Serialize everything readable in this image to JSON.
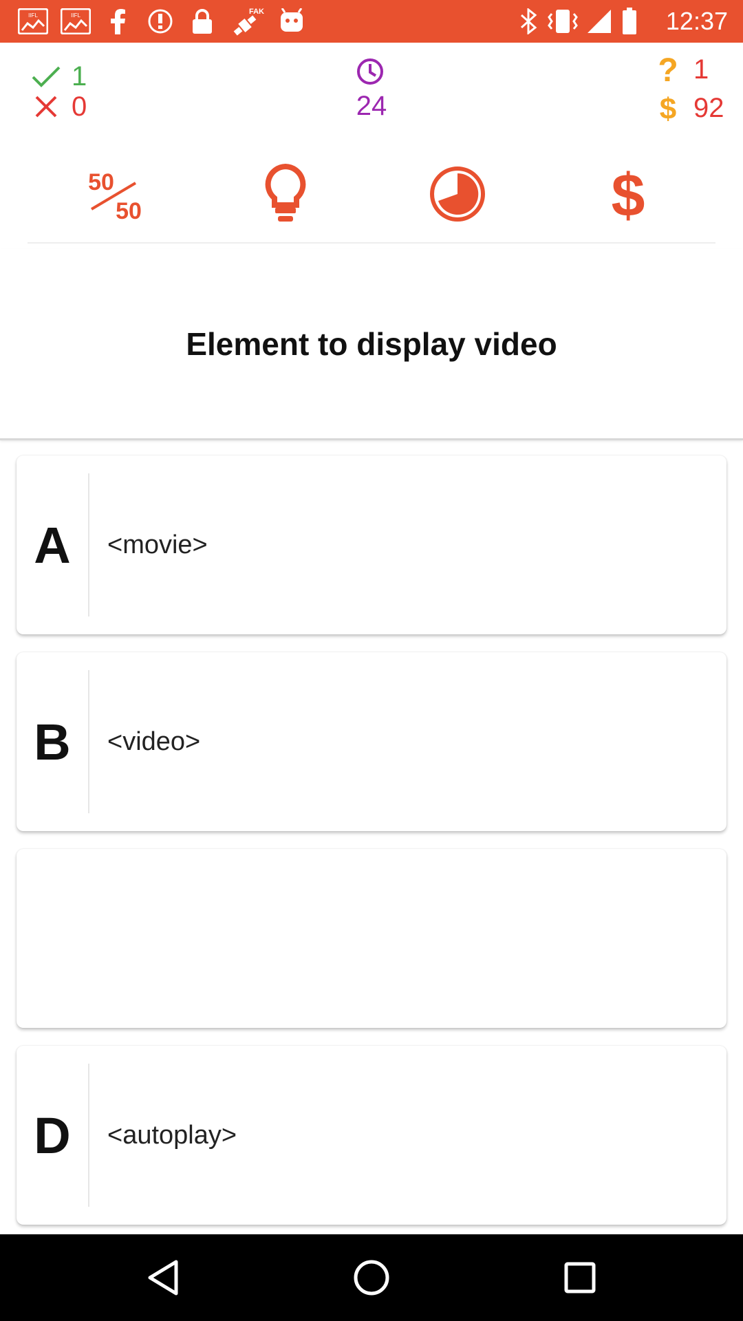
{
  "status_bar": {
    "time": "12:37",
    "icons": [
      "iifl-markets-icon",
      "iifl-markets-icon",
      "facebook-icon",
      "alert-circle-icon",
      "lock-icon",
      "fake-gps-icon",
      "android-icon",
      "bluetooth-icon",
      "vibrate-icon",
      "signal-icon",
      "battery-icon"
    ],
    "fake_label": "FAKE"
  },
  "stats": {
    "correct": "1",
    "wrong": "0",
    "timer": "24",
    "question_number": "1",
    "coins": "92"
  },
  "lifelines": {
    "fifty_top": "50",
    "fifty_bottom": "50",
    "coin_symbol": "$"
  },
  "question": {
    "text": "Element to display video"
  },
  "answers": [
    {
      "letter": "A",
      "text": "<movie>"
    },
    {
      "letter": "B",
      "text": "<video>"
    },
    {
      "letter": "",
      "text": ""
    },
    {
      "letter": "D",
      "text": "<autoplay>"
    }
  ],
  "colors": {
    "accent": "#E8512F",
    "correct": "#4CAF50",
    "wrong": "#E53935",
    "timer": "#9C27B0",
    "question_icon": "#F5A623",
    "coin_icon": "#F5A623",
    "coin_text": "#E53935"
  }
}
